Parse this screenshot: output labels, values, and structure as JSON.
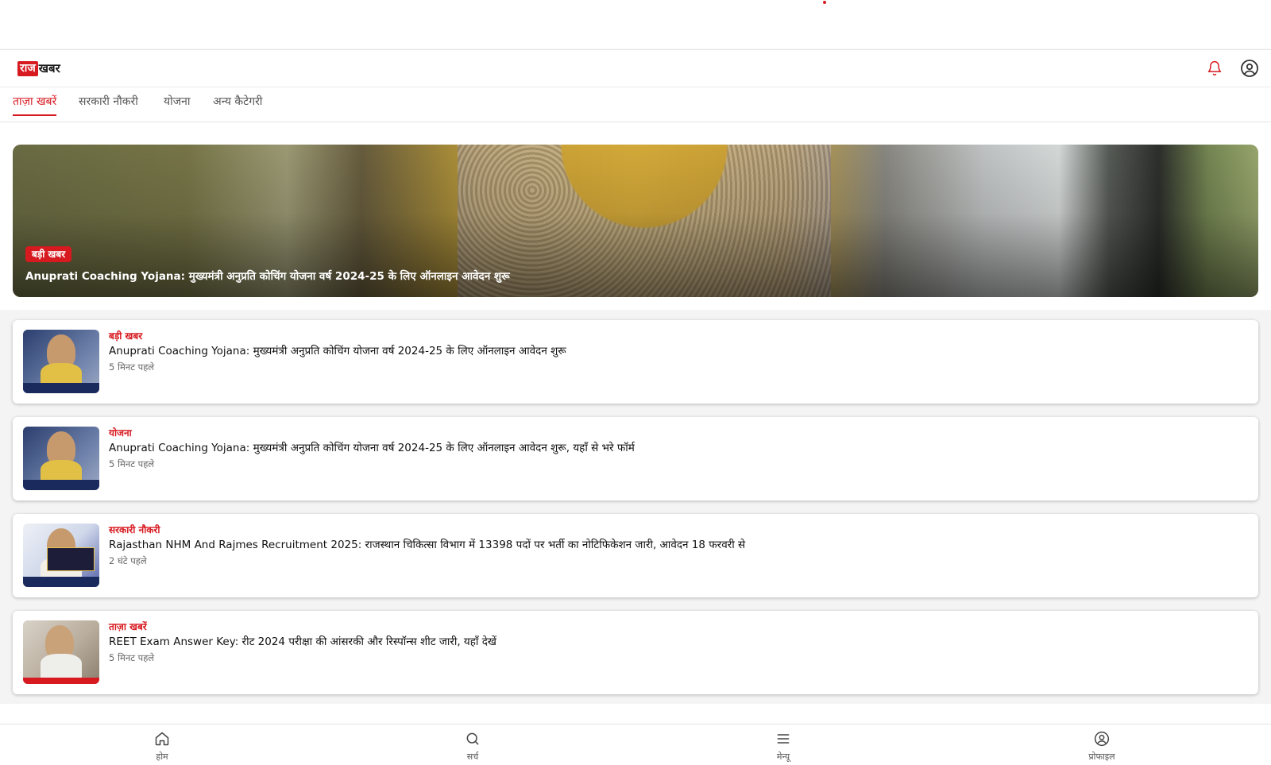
{
  "header": {
    "logo_part1": "राज",
    "logo_part2": "खबर",
    "accent_color": "#d71920",
    "icons": [
      "bell-icon",
      "user-circle-icon"
    ]
  },
  "tabs": [
    {
      "label": "ताज़ा खबरें",
      "active": true
    },
    {
      "label": "सरकारी नौकरी",
      "active": false
    },
    {
      "label": "योजना",
      "active": false
    },
    {
      "label": "अन्य कैटेगरी",
      "active": false
    }
  ],
  "hero": {
    "badge": "बड़ी खबर",
    "title": "Anuprati Coaching Yojana: मुख्यमंत्री अनुप्रति कोचिंग योजना वर्ष 2024-25 के लिए ऑनलाइन आवेदन शुरू"
  },
  "news_list": [
    {
      "category": "बड़ी खबर",
      "title": "Anuprati Coaching Yojana: मुख्यमंत्री अनुप्रति कोचिंग योजना वर्ष 2024-25 के लिए ऑनलाइन आवेदन शुरू",
      "time": "5 मिनट पहले"
    },
    {
      "category": "योजना",
      "title": "Anuprati Coaching Yojana: मुख्यमंत्री अनुप्रति कोचिंग योजना वर्ष 2024-25 के लिए ऑनलाइन आवेदन शुरू, यहाँ से भरे फॉर्म",
      "time": "5 मिनट पहले"
    },
    {
      "category": "सरकारी नौकरी",
      "title": "Rajasthan NHM And Rajmes Recruitment 2025: राजस्थान चिकित्सा विभाग में 13398 पदों पर भर्ती का नोटिफिकेशन जारी, आवेदन 18 फरवरी से",
      "time": "2 घंटे पहले"
    },
    {
      "category": "ताज़ा खबरें",
      "title": "REET Exam Answer Key: रीट 2024 परीक्षा की आंसरकी और रिस्पॉन्स शीट जारी, यहाँ देखें",
      "time": "5 मिनट पहले"
    }
  ],
  "bottom_nav": [
    {
      "label": "होम",
      "icon": "home-icon"
    },
    {
      "label": "सर्च",
      "icon": "search-icon"
    },
    {
      "label": "मेन्यू",
      "icon": "menu-icon"
    },
    {
      "label": "प्रोफाइल",
      "icon": "user-circle-icon"
    }
  ]
}
